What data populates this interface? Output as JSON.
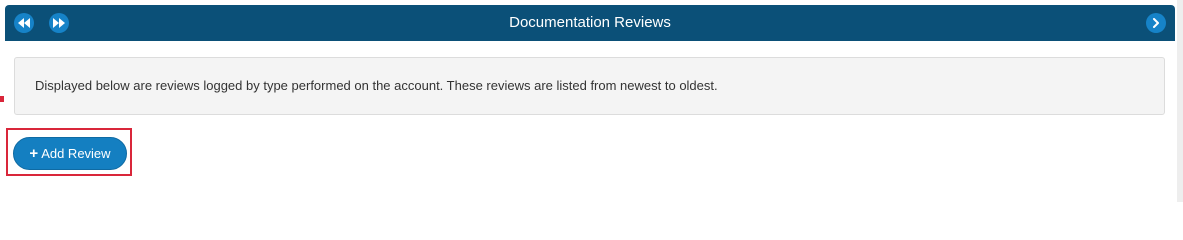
{
  "header": {
    "title": "Documentation Reviews",
    "icons": {
      "first": "double-chevron-left-icon",
      "previous": "double-chevron-right-icon",
      "next": "chevron-right-icon"
    },
    "colors": {
      "bar": "#0b5078",
      "nav_button": "#1683c8"
    }
  },
  "info": {
    "text": "Displayed below are reviews logged by type performed on the account. These reviews are listed from newest to oldest."
  },
  "actions": {
    "add_review_icon": "+",
    "add_review_label": "Add Review",
    "button_color": "#147fc1",
    "highlight_color": "#d9263a"
  }
}
